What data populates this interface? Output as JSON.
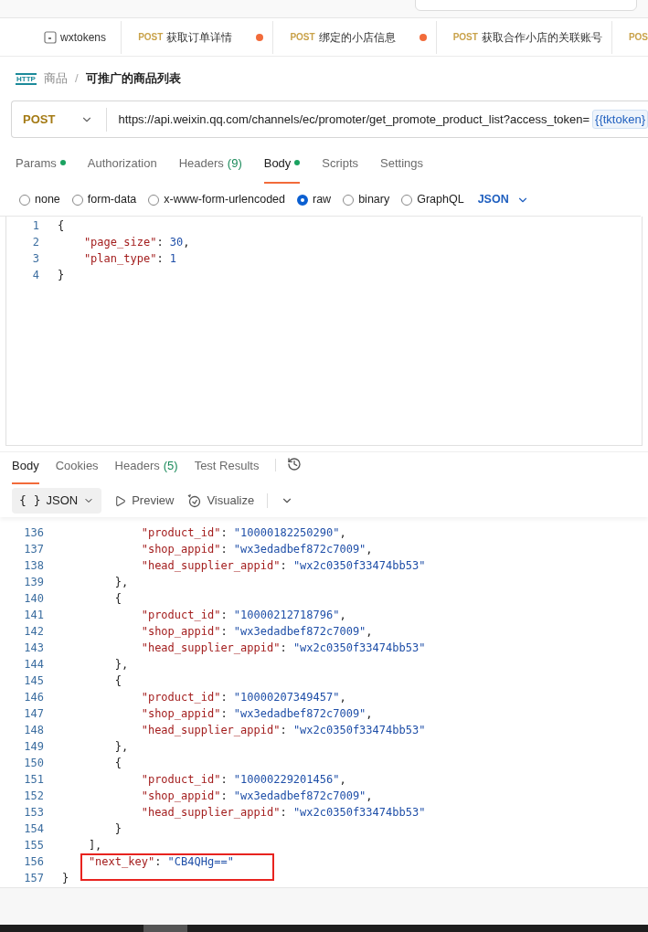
{
  "open_tabs": [
    {
      "kind": "collection",
      "label": "wxtokens",
      "unsaved": false
    },
    {
      "kind": "request",
      "method": "POST",
      "label": "获取订单详情",
      "unsaved": true
    },
    {
      "kind": "request",
      "method": "POST",
      "label": "绑定的小店信息",
      "unsaved": true
    },
    {
      "kind": "request",
      "method": "POST",
      "label": "获取合作小店的关联账号",
      "unsaved": false
    },
    {
      "kind": "request",
      "method": "POS",
      "unsaved": false
    }
  ],
  "breadcrumb": {
    "badge": "HTTP",
    "parent": "商品",
    "separator": "/",
    "current": "可推广的商品列表"
  },
  "request": {
    "method": "POST",
    "url": "https://api.weixin.qq.com/channels/ec/promoter/get_promote_product_list?access_token=",
    "variable": "{{tktoken}"
  },
  "request_sections": [
    {
      "label": "Params",
      "dot": true,
      "selected": false
    },
    {
      "label": "Authorization",
      "dot": false,
      "selected": false
    },
    {
      "label": "Headers",
      "count": "(9)",
      "dot": false,
      "selected": false
    },
    {
      "label": "Body",
      "dot": true,
      "selected": true
    },
    {
      "label": "Scripts",
      "dot": false,
      "selected": false
    },
    {
      "label": "Settings",
      "dot": false,
      "selected": false
    }
  ],
  "body_types": [
    {
      "label": "none",
      "selected": false
    },
    {
      "label": "form-data",
      "selected": false
    },
    {
      "label": "x-www-form-urlencoded",
      "selected": false
    },
    {
      "label": "raw",
      "selected": true
    },
    {
      "label": "binary",
      "selected": false
    },
    {
      "label": "GraphQL",
      "selected": false
    }
  ],
  "body_language": "JSON",
  "request_body": [
    {
      "n": "1",
      "tokens": [
        {
          "kind": "punct",
          "text": "{"
        }
      ]
    },
    {
      "n": "2",
      "tokens": [
        {
          "kind": "key",
          "text": "    \"page_size\""
        },
        {
          "kind": "punct",
          "text": ": "
        },
        {
          "kind": "number",
          "text": "30"
        },
        {
          "kind": "punct",
          "text": ","
        }
      ]
    },
    {
      "n": "3",
      "tokens": [
        {
          "kind": "key",
          "text": "    \"plan_type\""
        },
        {
          "kind": "punct",
          "text": ": "
        },
        {
          "kind": "number",
          "text": "1"
        }
      ]
    },
    {
      "n": "4",
      "tokens": [
        {
          "kind": "punct",
          "text": "}"
        }
      ]
    }
  ],
  "response_tabs": [
    {
      "label": "Body",
      "selected": true
    },
    {
      "label": "Cookies",
      "selected": false
    },
    {
      "label": "Headers",
      "count": "(5)",
      "selected": false
    },
    {
      "label": "Test Results",
      "selected": false
    }
  ],
  "response_toolbar": {
    "format_icon": "{ }",
    "format": "JSON",
    "preview": "Preview",
    "visualize": "Visualize"
  },
  "response_body": [
    {
      "n": "136",
      "tokens": [
        {
          "kind": "key",
          "text": "            \"product_id\""
        },
        {
          "kind": "punct",
          "text": ": "
        },
        {
          "kind": "string",
          "text": "\"10000182250290\""
        },
        {
          "kind": "punct",
          "text": ","
        }
      ]
    },
    {
      "n": "137",
      "tokens": [
        {
          "kind": "key",
          "text": "            \"shop_appid\""
        },
        {
          "kind": "punct",
          "text": ": "
        },
        {
          "kind": "string",
          "text": "\"wx3edadbef872c7009\""
        },
        {
          "kind": "punct",
          "text": ","
        }
      ]
    },
    {
      "n": "138",
      "tokens": [
        {
          "kind": "key",
          "text": "            \"head_supplier_appid\""
        },
        {
          "kind": "punct",
          "text": ": "
        },
        {
          "kind": "string",
          "text": "\"wx2c0350f33474bb53\""
        }
      ]
    },
    {
      "n": "139",
      "tokens": [
        {
          "kind": "punct",
          "text": "        },"
        }
      ]
    },
    {
      "n": "140",
      "tokens": [
        {
          "kind": "punct",
          "text": "        {"
        }
      ]
    },
    {
      "n": "141",
      "tokens": [
        {
          "kind": "key",
          "text": "            \"product_id\""
        },
        {
          "kind": "punct",
          "text": ": "
        },
        {
          "kind": "string",
          "text": "\"10000212718796\""
        },
        {
          "kind": "punct",
          "text": ","
        }
      ]
    },
    {
      "n": "142",
      "tokens": [
        {
          "kind": "key",
          "text": "            \"shop_appid\""
        },
        {
          "kind": "punct",
          "text": ": "
        },
        {
          "kind": "string",
          "text": "\"wx3edadbef872c7009\""
        },
        {
          "kind": "punct",
          "text": ","
        }
      ]
    },
    {
      "n": "143",
      "tokens": [
        {
          "kind": "key",
          "text": "            \"head_supplier_appid\""
        },
        {
          "kind": "punct",
          "text": ": "
        },
        {
          "kind": "string",
          "text": "\"wx2c0350f33474bb53\""
        }
      ]
    },
    {
      "n": "144",
      "tokens": [
        {
          "kind": "punct",
          "text": "        },"
        }
      ]
    },
    {
      "n": "145",
      "tokens": [
        {
          "kind": "punct",
          "text": "        {"
        }
      ]
    },
    {
      "n": "146",
      "tokens": [
        {
          "kind": "key",
          "text": "            \"product_id\""
        },
        {
          "kind": "punct",
          "text": ": "
        },
        {
          "kind": "string",
          "text": "\"10000207349457\""
        },
        {
          "kind": "punct",
          "text": ","
        }
      ]
    },
    {
      "n": "147",
      "tokens": [
        {
          "kind": "key",
          "text": "            \"shop_appid\""
        },
        {
          "kind": "punct",
          "text": ": "
        },
        {
          "kind": "string",
          "text": "\"wx3edadbef872c7009\""
        },
        {
          "kind": "punct",
          "text": ","
        }
      ]
    },
    {
      "n": "148",
      "tokens": [
        {
          "kind": "key",
          "text": "            \"head_supplier_appid\""
        },
        {
          "kind": "punct",
          "text": ": "
        },
        {
          "kind": "string",
          "text": "\"wx2c0350f33474bb53\""
        }
      ]
    },
    {
      "n": "149",
      "tokens": [
        {
          "kind": "punct",
          "text": "        },"
        }
      ]
    },
    {
      "n": "150",
      "tokens": [
        {
          "kind": "punct",
          "text": "        {"
        }
      ]
    },
    {
      "n": "151",
      "tokens": [
        {
          "kind": "key",
          "text": "            \"product_id\""
        },
        {
          "kind": "punct",
          "text": ": "
        },
        {
          "kind": "string",
          "text": "\"10000229201456\""
        },
        {
          "kind": "punct",
          "text": ","
        }
      ]
    },
    {
      "n": "152",
      "tokens": [
        {
          "kind": "key",
          "text": "            \"shop_appid\""
        },
        {
          "kind": "punct",
          "text": ": "
        },
        {
          "kind": "string",
          "text": "\"wx3edadbef872c7009\""
        },
        {
          "kind": "punct",
          "text": ","
        }
      ]
    },
    {
      "n": "153",
      "tokens": [
        {
          "kind": "key",
          "text": "            \"head_supplier_appid\""
        },
        {
          "kind": "punct",
          "text": ": "
        },
        {
          "kind": "string",
          "text": "\"wx2c0350f33474bb53\""
        }
      ]
    },
    {
      "n": "154",
      "tokens": [
        {
          "kind": "punct",
          "text": "        }"
        }
      ]
    },
    {
      "n": "155",
      "tokens": [
        {
          "kind": "punct",
          "text": "    ],"
        }
      ]
    },
    {
      "n": "156",
      "tokens": [
        {
          "kind": "key",
          "text": "    \"next_key\""
        },
        {
          "kind": "punct",
          "text": ": "
        },
        {
          "kind": "string",
          "text": "\"CB4QHg==\""
        }
      ]
    },
    {
      "n": "157",
      "tokens": [
        {
          "kind": "punct",
          "text": "}"
        }
      ]
    }
  ]
}
